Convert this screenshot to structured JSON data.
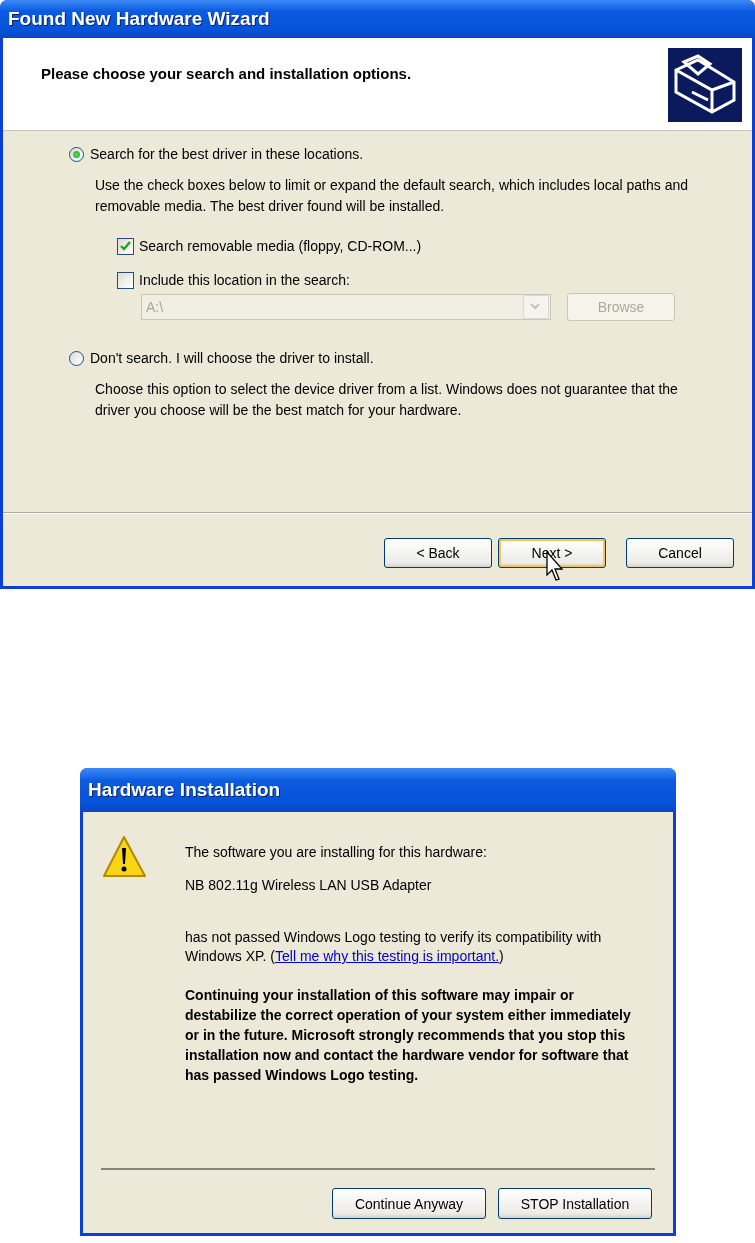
{
  "wizard": {
    "title": "Found New Hardware Wizard",
    "heading": "Please choose your search and installation options.",
    "options": [
      {
        "label": "Search for the best driver in these locations.",
        "selected": true,
        "description": "Use the check boxes below to limit or expand the default search, which includes local paths and removable media. The best driver found will be installed."
      },
      {
        "label": "Don't search. I will choose the driver to install.",
        "selected": false,
        "description": "Choose this option to select the device driver from a list.  Windows does not guarantee that the driver you choose will be the best match for your hardware."
      }
    ],
    "checkboxes": [
      {
        "label": "Search removable media (floppy, CD-ROM...)",
        "checked": true
      },
      {
        "label": "Include this location in the search:",
        "checked": false
      }
    ],
    "location": {
      "value": "A:\\",
      "disabled": true
    },
    "browse": {
      "label": "Browse",
      "disabled": true
    },
    "buttons": [
      {
        "label": "< Back",
        "focused": false
      },
      {
        "label": "Next >",
        "focused": true
      },
      {
        "label": "Cancel",
        "focused": false
      }
    ]
  },
  "warning": {
    "title": "Hardware Installation",
    "intro": "The software you are installing for this hardware:",
    "device": "NB 802.11g Wireless LAN USB Adapter",
    "notice": {
      "before": "has not passed Windows Logo testing to verify its compatibility with Windows XP. (",
      "link": "Tell me why this testing is important.",
      "after": ")"
    },
    "warning_text": "Continuing your installation of this software may impair or destabilize the correct operation of your system either immediately or in the future. Microsoft strongly recommends that you stop this installation now and contact the hardware vendor for software that has passed Windows Logo testing.",
    "buttons": [
      {
        "label": "Continue Anyway"
      },
      {
        "label": "STOP Installation"
      }
    ]
  }
}
